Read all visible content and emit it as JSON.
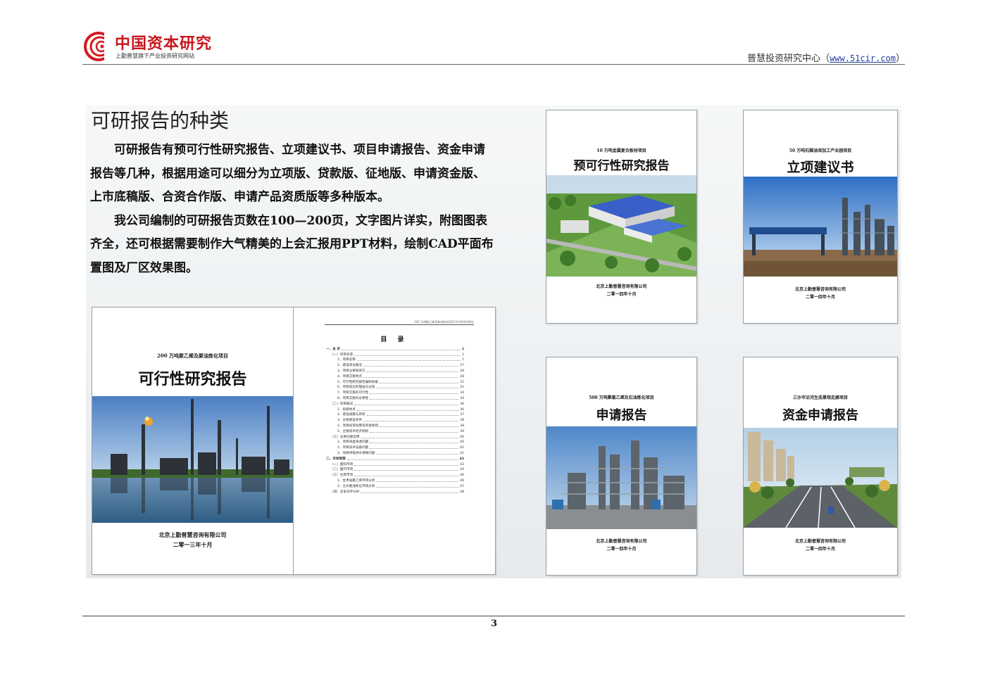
{
  "header": {
    "logo_name": "中国资本研究",
    "logo_tagline": "上勤普慧旗下产业投资研究网站",
    "org": "普慧投资研究中心（",
    "url": "www.51cir.com",
    "org_close": "）"
  },
  "section": {
    "title": "可研报告的种类",
    "paragraph1": "可研报告有预可行性研究报告、立项建议书、项目申请报告、资金申请报告等几种，根据用途可以细分为立项版、贷款版、征地版、申请资金版、上市底稿版、合资合作版、申请产品资质版等多种版本。",
    "paragraph2": "我公司编制的可研报告页数在100—200页，文字图片详实，附图图表齐全，还可根据需要制作大气精美的上会汇报用PPT材料，绘制CAD平面布置图及厂区效果图。"
  },
  "covers": {
    "feasibility": {
      "project": "200 万吨聚乙烯及聚油炼化项目",
      "title": "可行性研究报告",
      "company": "北京上勤普慧咨询有限公司",
      "date": "二零一三年十月"
    },
    "pre_feasibility": {
      "project": "10 万吨金属复合板材项目",
      "title": "预可行性研究报告",
      "company": "北京上勤普慧咨询有限公司",
      "date": "二零一四年十月"
    },
    "proposal": {
      "project": "50 万吨石脑油深加工产业园项目",
      "title": "立项建议书",
      "company": "北京上勤普慧咨询有限公司",
      "date": "二零一四年十月"
    },
    "application": {
      "project": "500 万吨聚氯乙烯及石油炼化项目",
      "title": "申请报告",
      "company": "北京上勤普慧咨询有限公司",
      "date": "二零一四年十月"
    },
    "funding": {
      "project": "三沙市沿河生态景观走廊项目",
      "title": "资金申请报告",
      "company": "北京上勤普慧咨询有限公司",
      "date": "二零一四年十月"
    }
  },
  "toc": {
    "header": "200 万吨聚乙烯及聚油炼化项目可行性研究报告",
    "title": "目 录",
    "rows": [
      {
        "level": 1,
        "text": "一、总 论",
        "page": "1"
      },
      {
        "level": 2,
        "text": "（一）项目背景",
        "page": "1"
      },
      {
        "level": 3,
        "text": "1、项目名称",
        "page": "1"
      },
      {
        "level": 3,
        "text": "2、建设单位概况",
        "page": "27"
      },
      {
        "level": 3,
        "text": "3、项目主要投资方",
        "page": "28"
      },
      {
        "level": 3,
        "text": "4、项目实施地点",
        "page": "28"
      },
      {
        "level": 3,
        "text": "5、可行性研究报告编制依据",
        "page": "31"
      },
      {
        "level": 3,
        "text": "6、项目提出的理由与过程",
        "page": "31"
      },
      {
        "level": 3,
        "text": "7、项目实施的可行性",
        "page": "34"
      },
      {
        "level": 3,
        "text": "8、项目实施的必要性",
        "page": "34"
      },
      {
        "level": 2,
        "text": "（二）项目概况",
        "page": "36"
      },
      {
        "level": 3,
        "text": "1、拟建地点",
        "page": "36"
      },
      {
        "level": 3,
        "text": "2、建设规模与目标",
        "page": "37"
      },
      {
        "level": 3,
        "text": "3、主要建设条件",
        "page": "38"
      },
      {
        "level": 3,
        "text": "4、项目投资估算及资金筹措",
        "page": "38"
      },
      {
        "level": 3,
        "text": "5、主要技术经济指标",
        "page": "39"
      },
      {
        "level": 2,
        "text": "（三）主要问题说明",
        "page": "40"
      },
      {
        "level": 3,
        "text": "1、项目资金来源问题",
        "page": "40"
      },
      {
        "level": 3,
        "text": "2、项目技术设备问题",
        "page": "41"
      },
      {
        "level": 3,
        "text": "3、项目供电供水保障问题",
        "page": "41"
      },
      {
        "level": 1,
        "text": "二、市场预测",
        "page": "42"
      },
      {
        "level": 2,
        "text": "（一）国际市场",
        "page": "42"
      },
      {
        "level": 2,
        "text": "（二）国内市场",
        "page": "44"
      },
      {
        "level": 2,
        "text": "（三）甘肃市场",
        "page": "46"
      },
      {
        "level": 3,
        "text": "1、甘肃省聚乙烯市场分析",
        "page": "46"
      },
      {
        "level": 3,
        "text": "2、兰州重油炼化市场分析",
        "page": "47"
      },
      {
        "level": 2,
        "text": "（四）竞争对手分析",
        "page": "48"
      }
    ]
  },
  "footer": {
    "page_number": "3"
  }
}
